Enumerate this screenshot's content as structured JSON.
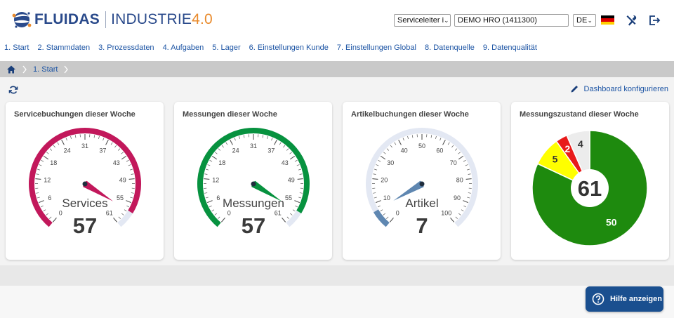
{
  "header": {
    "brand": "FLUIDAS",
    "subtitle": "INDUSTRIE",
    "version": "4.0",
    "role_select": "Serviceleiter i",
    "client_select": "DEMO HRO (1411300)",
    "lang_select": "DE",
    "icons": [
      "flag-germany-icon",
      "tools-icon",
      "logout-icon"
    ]
  },
  "nav": {
    "items": [
      "1. Start",
      "2. Stammdaten",
      "3. Prozessdaten",
      "4. Aufgaben",
      "5. Lager",
      "6. Einstellungen Kunde",
      "7. Einstellungen Global",
      "8. Datenquelle",
      "9. Datenqualität"
    ]
  },
  "breadcrumb": {
    "current": "1. Start"
  },
  "toolbar": {
    "configure_label": "Dashboard konfigurieren"
  },
  "colors": {
    "brand_blue": "#2a4a8b",
    "link_blue": "#1c54a4",
    "accent_orange": "#e98a2b",
    "gauge_magenta": "#c2185b",
    "gauge_green": "#07923f",
    "gauge_blue": "#5f87b1",
    "pie_green": "#1e8a0e",
    "pie_yellow": "#ffff00",
    "pie_red": "#e81a1a",
    "pie_grey": "#ececec"
  },
  "cards": [
    {
      "title": "Servicebuchungen dieser Woche",
      "label": "Services",
      "value": "57",
      "gauge": {
        "min": 0,
        "max": 61,
        "value": 57,
        "ticks": [
          "0",
          "6",
          "12",
          "18",
          "24",
          "31",
          "37",
          "43",
          "49",
          "55",
          "61"
        ]
      }
    },
    {
      "title": "Messungen dieser Woche",
      "label": "Messungen",
      "value": "57",
      "gauge": {
        "min": 0,
        "max": 61,
        "value": 57,
        "ticks": [
          "0",
          "6",
          "12",
          "18",
          "24",
          "31",
          "37",
          "43",
          "49",
          "55",
          "61"
        ]
      }
    },
    {
      "title": "Artikelbuchungen dieser Woche",
      "label": "Artikel",
      "value": "7",
      "gauge": {
        "min": 0,
        "max": 100,
        "value": 7,
        "ticks": [
          "0",
          "10",
          "20",
          "30",
          "40",
          "50",
          "60",
          "70",
          "80",
          "90",
          "100"
        ]
      }
    },
    {
      "title": "Messungszustand dieser Woche",
      "total": "61"
    }
  ],
  "chart_data": {
    "type": "pie",
    "title": "Messungszustand dieser Woche",
    "center_label": "61",
    "slices": [
      {
        "value": 50,
        "label": "50",
        "color": "#1e8a0e"
      },
      {
        "value": 5,
        "label": "5",
        "color": "#ffff00"
      },
      {
        "value": 2,
        "label": "2",
        "color": "#e81a1a"
      },
      {
        "value": 4,
        "label": "4",
        "color": "#ececec"
      }
    ]
  },
  "help": {
    "label": "Hilfe anzeigen"
  }
}
